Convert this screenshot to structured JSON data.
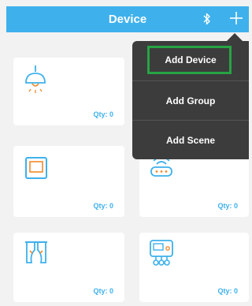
{
  "header": {
    "title": "Device",
    "bluetooth_icon": "bluetooth-icon",
    "add_icon": "plus-icon"
  },
  "tiles": [
    {
      "icon": "ceiling-lamp-icon",
      "qty": "Qty: 0"
    },
    {
      "icon": "wall-switch-icon",
      "qty": "Qty: 0"
    },
    {
      "icon": "wifi-gateway-icon",
      "qty": "Qty: 0"
    },
    {
      "icon": "curtain-icon",
      "qty": "Qty: 0"
    },
    {
      "icon": "thermostat-panel-icon",
      "qty": "Qty: 0"
    }
  ],
  "menu": {
    "items": [
      {
        "label": "Add Device"
      },
      {
        "label": "Add Group"
      },
      {
        "label": "Add Scene"
      }
    ],
    "highlight_color": "#27a444"
  },
  "colors": {
    "accent": "#3eb1ec",
    "icon_orange": "#f08a2c",
    "menu_bg": "#3c3c3c"
  }
}
